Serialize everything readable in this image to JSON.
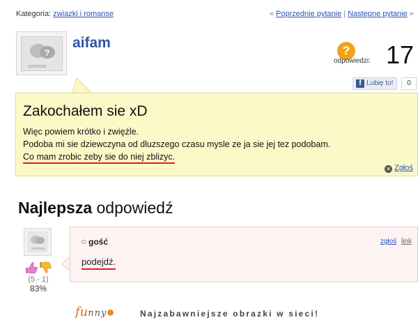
{
  "topbar": {
    "category_label": "Kategoria:",
    "category_link": "zwiazki i romanse",
    "prev_marker": "«",
    "prev_link": "Poprzednie pytanie",
    "separator": "|",
    "next_link": "Nastepne pytanie",
    "next_marker": "»"
  },
  "avatar": {
    "label": "samosia"
  },
  "user": {
    "name": "aifam"
  },
  "answers": {
    "icon": "question-badge-icon",
    "label": "odpowiedzi:",
    "count": "17"
  },
  "like": {
    "label": "Lubię to!",
    "count": "0"
  },
  "question": {
    "title": "Zakochałem sie xD",
    "line1": "Więc powiem krótko i zwięźle.",
    "line2": "Podoba mi sie dziewczyna od dluzszego czasu mysle ze ja sie jej tez podobam.",
    "line3": "Co mam zrobic zeby sie do niej zblizyc.",
    "report": "Zgłoś"
  },
  "best_answer": {
    "heading_bold": "Najlepsza",
    "heading_rest": "odpowiedź"
  },
  "answer": {
    "author": "gość",
    "report_link": "zgłoś",
    "link": "link",
    "text": "podejdź.",
    "votes": "(5 - 1)",
    "percent": "83%"
  },
  "footer": {
    "logo_main": "fu",
    "logo_rest": "nny",
    "tagline": "Najzabawniejsze obrazki w sieci!"
  },
  "colors": {
    "link": "#2a54b6",
    "question_bg": "#fdf8c8",
    "answer_bg": "#fdf3f3",
    "underline": "#e11b22",
    "accent": "#f0a41a"
  }
}
